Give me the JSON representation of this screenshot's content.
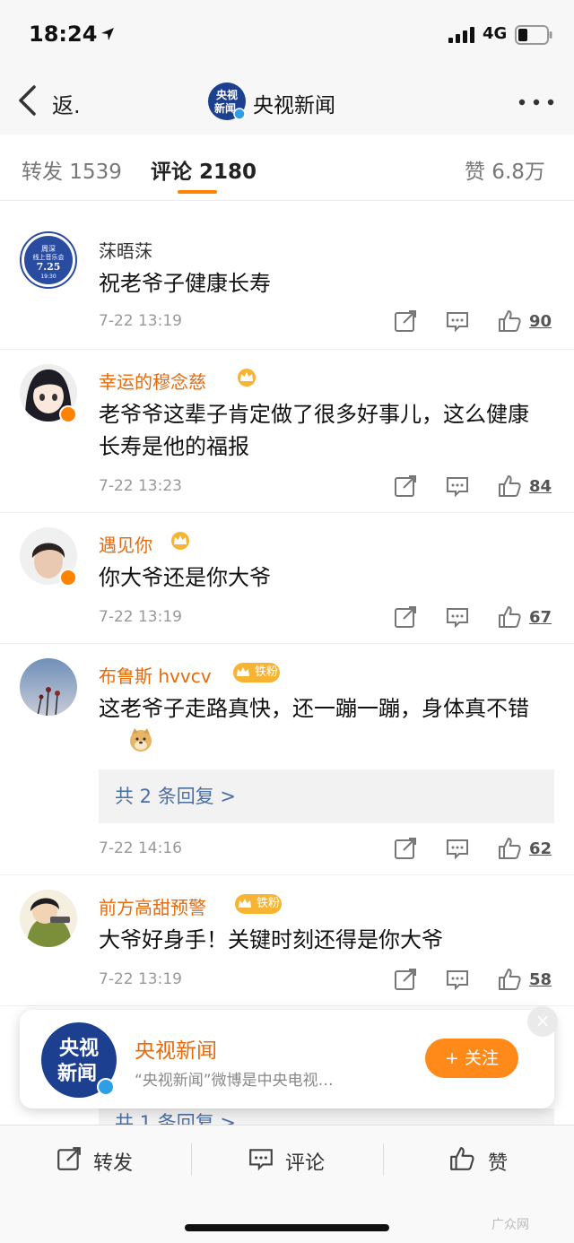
{
  "status_bar": {
    "time": "18:24",
    "network": "4G"
  },
  "navbar": {
    "back_label": "返.",
    "title": "央视新闻",
    "avatar_text": "央视\n新闻"
  },
  "tabs": [
    {
      "label": "转发 1539"
    },
    {
      "label": "评论 2180"
    },
    {
      "label": "赞 6.8万"
    }
  ],
  "comments": [
    {
      "user": "莯晤莯",
      "text": "祝老爷子健康长寿",
      "time": "7-22 13:19",
      "likes": "90",
      "avatar_text": "周深\n线上音乐会\n7.25\n19:30"
    },
    {
      "user": "幸运的穆念慈",
      "text": "老爷爷这辈子肯定做了很多好事儿，这么健康长寿是他的福报",
      "time": "7-22 13:23",
      "likes": "84"
    },
    {
      "user": "遇见你",
      "text": "你大爷还是你大爷",
      "time": "7-22 13:19",
      "likes": "67"
    },
    {
      "user": "布鲁斯 hvvcv",
      "badge": "铁粉",
      "text": "这老爷子走路真快，还一蹦一蹦，身体真不错",
      "time": "7-22 14:16",
      "likes": "62",
      "replies": "共 2 条回复 >"
    },
    {
      "user": "前方高甜预警",
      "badge": "铁粉",
      "text": "大爷好身手！关键时刻还得是你大爷",
      "time": "7-22 13:19",
      "likes": "58"
    }
  ],
  "follow_card": {
    "name": "央视新闻",
    "description": "“央视新闻”微博是中央电视…",
    "button": "+ 关注",
    "logo_text": "央视\n新闻",
    "close": "×"
  },
  "hidden_reply_peek": "共 1 条回复 >",
  "toolbar": {
    "repost": "转发",
    "comment": "评论",
    "like": "赞"
  },
  "watermark": "广众网",
  "colors": {
    "accent": "#ff8200",
    "vip_name": "#e66b0c",
    "reply_link": "#4a6fa5",
    "brand_blue": "#1c3f8f"
  },
  "icons": [
    "location-arrow-icon",
    "signal-icon",
    "battery-icon",
    "back-chevron-icon",
    "more-dots-icon",
    "crown-icon",
    "repost-icon",
    "comment-icon",
    "like-icon",
    "close-icon"
  ]
}
